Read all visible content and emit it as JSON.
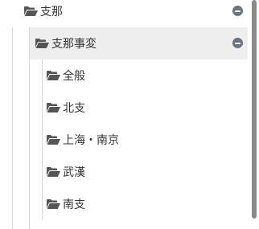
{
  "tree": {
    "root": {
      "label": "支那",
      "icon": "folder-open-icon",
      "toggle_icon": "collapse-icon"
    },
    "child": {
      "label": "支那事変",
      "icon": "folder-open-icon",
      "toggle_icon": "collapse-icon",
      "selected": true
    },
    "leaves": [
      {
        "label": "全般",
        "icon": "folder-open-icon"
      },
      {
        "label": "北支",
        "icon": "folder-open-icon"
      },
      {
        "label": "上海・南京",
        "icon": "folder-open-icon"
      },
      {
        "label": "武漢",
        "icon": "folder-open-icon"
      },
      {
        "label": "南支",
        "icon": "folder-open-icon"
      }
    ]
  },
  "colors": {
    "selected_bg": "#eeeeee",
    "icon": "#555555",
    "toggle": "#6c757d",
    "guide_line": "#d8d8d8",
    "scrollbar": "#8a8a8a"
  }
}
